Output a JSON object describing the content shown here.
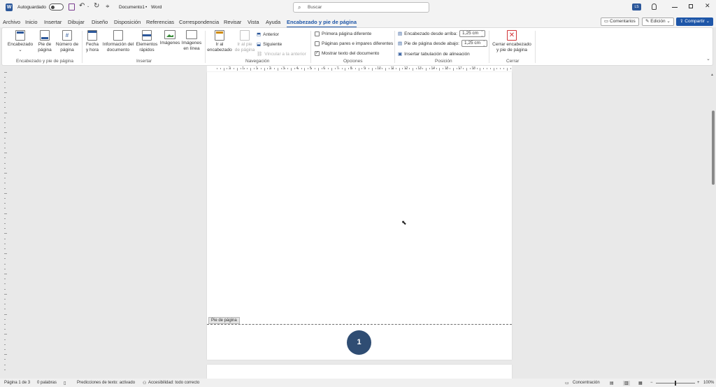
{
  "titlebar": {
    "autosave_label": "Autoguardado",
    "doc_title": "Documento1",
    "separator": "•",
    "app_name": "Word",
    "search_placeholder": "Buscar",
    "avatar_initials": "LS"
  },
  "tabs": [
    "Archivo",
    "Inicio",
    "Insertar",
    "Dibujar",
    "Diseño",
    "Disposición",
    "Referencias",
    "Correspondencia",
    "Revisar",
    "Vista",
    "Ayuda",
    "Encabezado y pie de página"
  ],
  "top_buttons": {
    "comments": "Comentarios",
    "editing": "Edición",
    "share": "Compartir"
  },
  "ribbon": {
    "hf": {
      "encabezado": "Encabezado",
      "pie": "Pie de",
      "pie2": "página",
      "numero": "Número de",
      "numero2": "página",
      "group": "Encabezado y pie de página"
    },
    "insert": {
      "fecha": "Fecha",
      "fecha2": "y hora",
      "info": "Información del",
      "info2": "documento",
      "elem": "Elementos",
      "elem2": "rápidos",
      "imagenes": "Imágenes",
      "imgline": "Imágenes",
      "imgline2": "en línea",
      "group": "Insertar"
    },
    "nav": {
      "ir_enc": "Ir al",
      "ir_enc2": "encabezado",
      "ir_pie": "Ir al pie",
      "ir_pie2": "de página",
      "anterior": "Anterior",
      "siguiente": "Siguiente",
      "vincular": "Vincular a la anterior",
      "group": "Navegación"
    },
    "options": {
      "primera": "Primera página diferente",
      "pares": "Páginas pares e impares diferentes",
      "mostrar": "Mostrar texto del documento",
      "group": "Opciones"
    },
    "position": {
      "enc_arriba": "Encabezado desde arriba:",
      "enc_val": "1,25 cm",
      "pie_abajo": "Pie de página desde abajo:",
      "pie_val": "1,25 cm",
      "tab": "Insertar tabulación de alineación",
      "group": "Posición"
    },
    "close": {
      "label": "Cerrar encabezado",
      "label2": "y pie de página",
      "group": "Cerrar"
    }
  },
  "ruler_numbers": [
    "2",
    "1",
    "1",
    "2",
    "3",
    "4",
    "5",
    "6",
    "7",
    "8",
    "9",
    "10",
    "11",
    "12",
    "13",
    "14",
    "15",
    "17",
    "18"
  ],
  "document": {
    "footer_label": "Pie de página",
    "page_number": "1"
  },
  "statusbar": {
    "page": "Página 1 de 3",
    "words": "0 palabras",
    "predictions": "Predicciones de texto: activado",
    "accessibility": "Accesibilidad: todo correcto",
    "focus": "Concentración",
    "zoom": "100%"
  },
  "colors": {
    "accent": "#1e56a8",
    "page_number_circle": "#2f4d73",
    "close_icon": "#d13438",
    "share": "#1e56a8"
  }
}
